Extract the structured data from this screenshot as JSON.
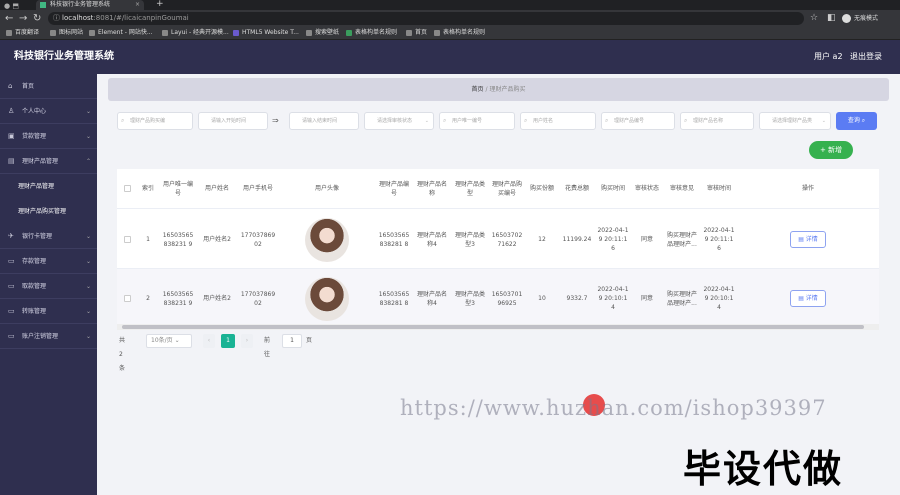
{
  "browser": {
    "tab_title": "科技银行业务管理系统",
    "url_host": "localhost",
    "url_path": ":8081/#/licaicanpinGoumai",
    "profile": "无痕模式",
    "bookmarks": [
      "百度翻译",
      "图标网站",
      "Element - 网站快...",
      "Layui - 经典开源模...",
      "HTML5 Website T...",
      "搜索壁纸",
      "表格构单名规则",
      "首页",
      "表格构单名规则"
    ]
  },
  "header": {
    "title": "科技银行业务管理系统",
    "user": "用户 a2",
    "logout": "退出登录"
  },
  "sidebar": {
    "items": [
      {
        "label": "首页",
        "icon": "home-icon"
      },
      {
        "label": "个人中心",
        "icon": "user-icon"
      },
      {
        "label": "贷款管理",
        "icon": "loan-icon"
      },
      {
        "label": "理财产品管理",
        "icon": "product-icon"
      },
      {
        "label": "理财产品管理",
        "icon": ""
      },
      {
        "label": "理财产品购买管理",
        "icon": ""
      },
      {
        "label": "银行卡管理",
        "icon": "card-icon"
      },
      {
        "label": "存款管理",
        "icon": "deposit-icon"
      },
      {
        "label": "取款管理",
        "icon": "withdraw-icon"
      },
      {
        "label": "转账管理",
        "icon": "transfer-icon"
      },
      {
        "label": "账户注销管理",
        "icon": "account-icon"
      }
    ]
  },
  "breadcrumb": {
    "home": "首页",
    "sep": "/",
    "current": "理财产品购买"
  },
  "filters": {
    "items": [
      "理财产品购买编",
      "请输入开始时间",
      "请输入结束时间",
      "请选择审核状态",
      "用户唯一编号",
      "用户姓名",
      "理财产品编号",
      "理财产品名称",
      "请选择理财产品类"
    ],
    "range_sep": "⇒",
    "search": "查询"
  },
  "add_button": "+ 新增",
  "table": {
    "columns": [
      "索引",
      "用户唯一编号",
      "用户姓名",
      "用户手机号",
      "用户头像",
      "理财产品编号",
      "理财产品名称",
      "理财产品类型",
      "理财产品购买编号",
      "购买份额",
      "花费总额",
      "购买时间",
      "审核状态",
      "审核意见",
      "审核时间",
      "操作"
    ],
    "rows": [
      {
        "index": "1",
        "uid": "16503565838231 9",
        "name": "用户姓名2",
        "phone": "17703786902",
        "pid": "16503565838281 8",
        "pname": "理财产品名称4",
        "ptype": "理财产品类型3",
        "buyno": "1650370271622",
        "share": "12",
        "total": "11199.24",
        "time": "2022-04-19 20:11:16",
        "status": "同意",
        "opinion": "购买理财产品理财产...",
        "atime": "2022-04-19 20:11:16",
        "op": "详情"
      },
      {
        "index": "2",
        "uid": "16503565838231 9",
        "name": "用户姓名2",
        "phone": "17703786902",
        "pid": "16503565838281 8",
        "pname": "理财产品名称4",
        "ptype": "理财产品类型3",
        "buyno": "1650370196925",
        "share": "10",
        "total": "9332.7",
        "time": "2022-04-19 20:10:14",
        "status": "同意",
        "opinion": "购买理财产品理财产...",
        "atime": "2022-04-19 20:10:14",
        "op": "详情"
      }
    ]
  },
  "pager": {
    "total": "共 2 条",
    "size": "10条/页",
    "current": "1",
    "goto": "前往",
    "page": "1",
    "unit": "页"
  },
  "watermark": "https://www.huzhan.com/ishop39397",
  "promo": "毕设代做"
}
